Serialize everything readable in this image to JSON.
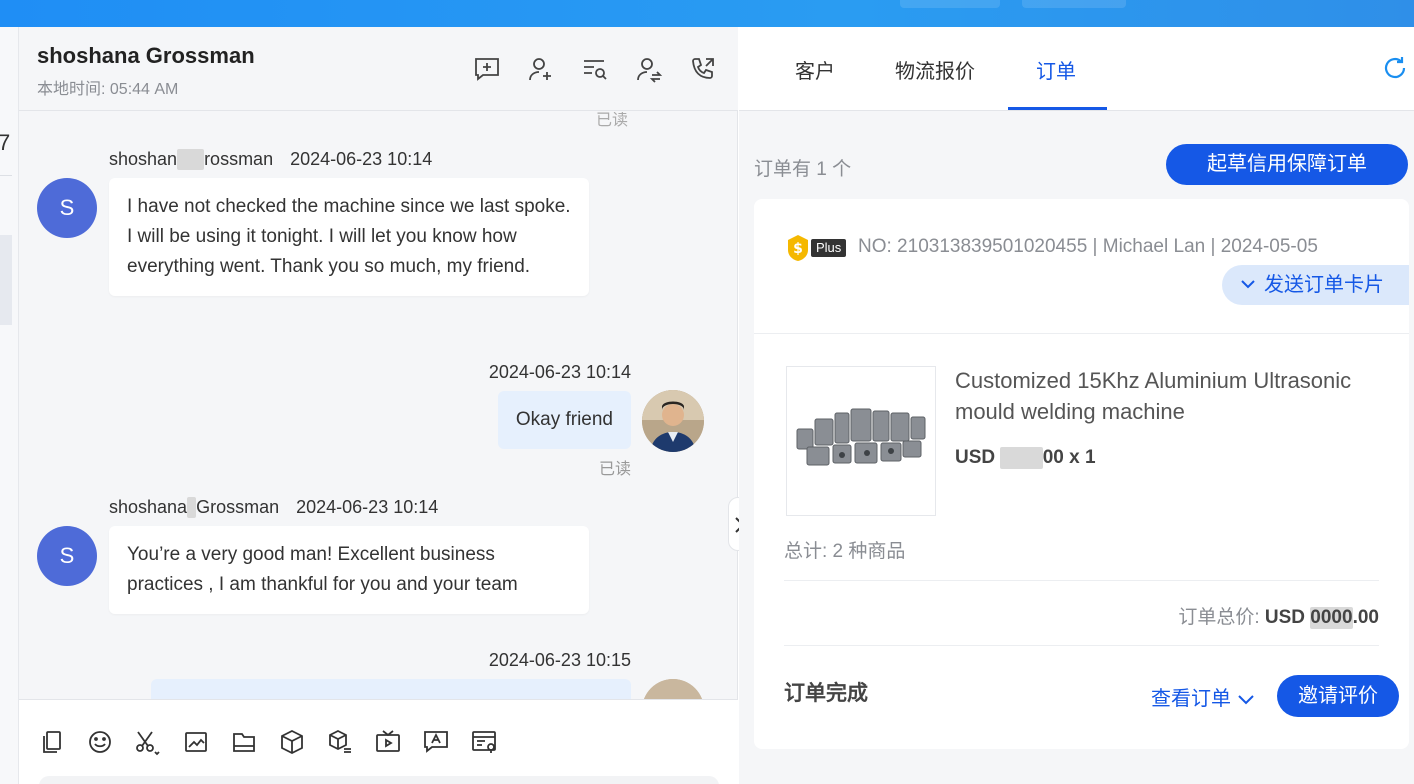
{
  "colors": {
    "accent": "#1558e6",
    "avatar_bg": "#4e6bd8",
    "topbar": "#1f8ef5",
    "outgoing_bubble": "#e6f0fd"
  },
  "left_strip": {
    "partial_digit": "7"
  },
  "chat": {
    "contact_name": "shoshana Grossman",
    "local_time": "本地时间: 05:44 AM",
    "header_icons": [
      "add-chat-icon",
      "add-contact-icon",
      "search-messages-icon",
      "transfer-contact-icon",
      "call-icon"
    ],
    "top_read_label": "已读",
    "messages": [
      {
        "direction": "in",
        "sender_a": "shoshan",
        "sender_b": "rossman",
        "timestamp": "2024-06-23 10:14",
        "avatar_letter": "S",
        "text": "I have not checked the machine since we last spoke. I will be using it tonight. I will let you know how everything went. Thank you so much, my friend."
      },
      {
        "direction": "out",
        "timestamp": "2024-06-23 10:14",
        "text": "Okay friend",
        "status": "已读"
      },
      {
        "direction": "in",
        "sender_a": "shoshana",
        "sender_b": "Grossman",
        "timestamp": "2024-06-23 10:14",
        "avatar_letter": "S",
        "text": "You’re a very good man! Excellent business practices , I am thankful for you and your team"
      },
      {
        "direction": "out",
        "timestamp": "2024-06-23 10:15"
      }
    ],
    "toolbar_icons": [
      "copy-icon",
      "emoji-icon",
      "screenshot-icon",
      "image-icon",
      "file-icon",
      "product-icon",
      "products-list-icon",
      "video-icon",
      "translate-icon",
      "order-address-icon"
    ]
  },
  "right_panel": {
    "tabs": [
      {
        "label": "客户",
        "active": false
      },
      {
        "label": "物流报价",
        "active": false
      },
      {
        "label": "订单",
        "active": true
      }
    ],
    "order_count": "订单有 1 个",
    "draft_button": "起草信用保障订单",
    "order": {
      "badge": "Plus",
      "meta": "NO: 210313839501020455 | Michael Lan | 2024-05-05",
      "send_card": "发送订单卡片",
      "product_title": "Customized 15Khz Aluminium Ultrasonic mould welding machine",
      "price_prefix": "USD",
      "price_suffix": "00 x 1",
      "total_items": "总计: 2 种商品",
      "total_label": "订单总价:",
      "total_prefix": "USD",
      "total_suffix": ".00",
      "status": "订单完成",
      "view_order": "查看订单",
      "invite_review": "邀请评价"
    }
  }
}
